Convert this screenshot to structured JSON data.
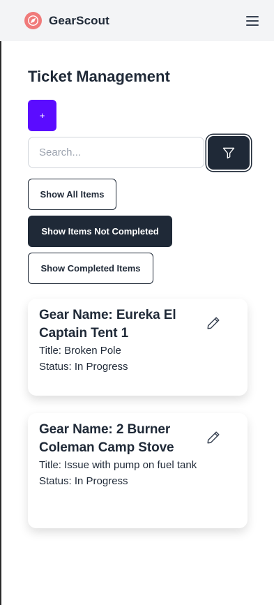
{
  "header": {
    "brand": "GearScout",
    "logo_icon": "compass-icon",
    "logo_color": "#f07a7a",
    "menu_icon": "hamburger-menu-icon"
  },
  "page": {
    "title": "Ticket Management"
  },
  "toolbar": {
    "add_label": "+",
    "add_color": "#5b0cff",
    "search_placeholder": "Search...",
    "search_value": "",
    "filter_icon": "filter-icon"
  },
  "filters": {
    "show_all": "Show All Items",
    "show_not_completed": "Show Items Not Completed",
    "show_completed": "Show Completed Items",
    "active": "show_not_completed"
  },
  "tickets": [
    {
      "gear_name": "Gear Name: Eureka El Captain Tent 1",
      "title": "Title: Broken Pole",
      "status": "Status: In Progress",
      "edit_icon": "pencil-icon"
    },
    {
      "gear_name": "Gear Name: 2 Burner Coleman Camp Stove",
      "title": "Title: Issue with pump on fuel tank",
      "status": "Status: In Progress",
      "edit_icon": "pencil-icon"
    }
  ]
}
